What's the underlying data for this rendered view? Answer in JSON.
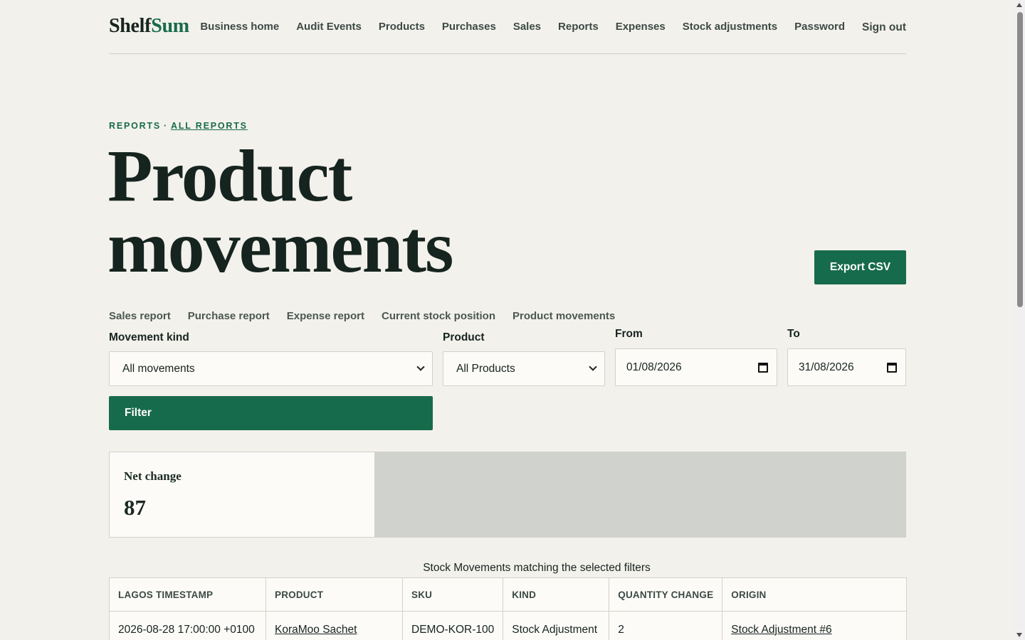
{
  "logo": {
    "part1": "Shelf",
    "part2": "Sum"
  },
  "nav": [
    "Business home",
    "Audit Events",
    "Products",
    "Purchases",
    "Sales",
    "Reports",
    "Expenses",
    "Stock adjustments",
    "Password"
  ],
  "nav_signout": "Sign out",
  "breadcrumb": {
    "section": "REPORTS",
    "separator": "·",
    "link": "ALL REPORTS"
  },
  "title": "Product movements",
  "export_label": "Export CSV",
  "tabs": [
    "Sales report",
    "Purchase report",
    "Expense report",
    "Current stock position",
    "Product movements"
  ],
  "filters": {
    "kind_label": "Movement kind",
    "kind_value": "All movements",
    "product_label": "Product",
    "product_value": "All Products",
    "from_label": "From",
    "from_value": "01/08/2026",
    "to_label": "To",
    "to_value": "31/08/2026",
    "filter_label": "Filter"
  },
  "summary": {
    "label": "Net change",
    "value": "87"
  },
  "table": {
    "caption": "Stock Movements matching the selected filters",
    "headers": [
      "LAGOS TIMESTAMP",
      "PRODUCT",
      "SKU",
      "KIND",
      "QUANTITY CHANGE",
      "ORIGIN"
    ],
    "rows": [
      {
        "timestamp": "2026-08-28 17:00:00 +0100",
        "product": "KoraMoo Sachet",
        "sku": "DEMO-KOR-100",
        "kind": "Stock Adjustment",
        "quantity": "2",
        "origin": "Stock Adjustment #6"
      }
    ]
  }
}
